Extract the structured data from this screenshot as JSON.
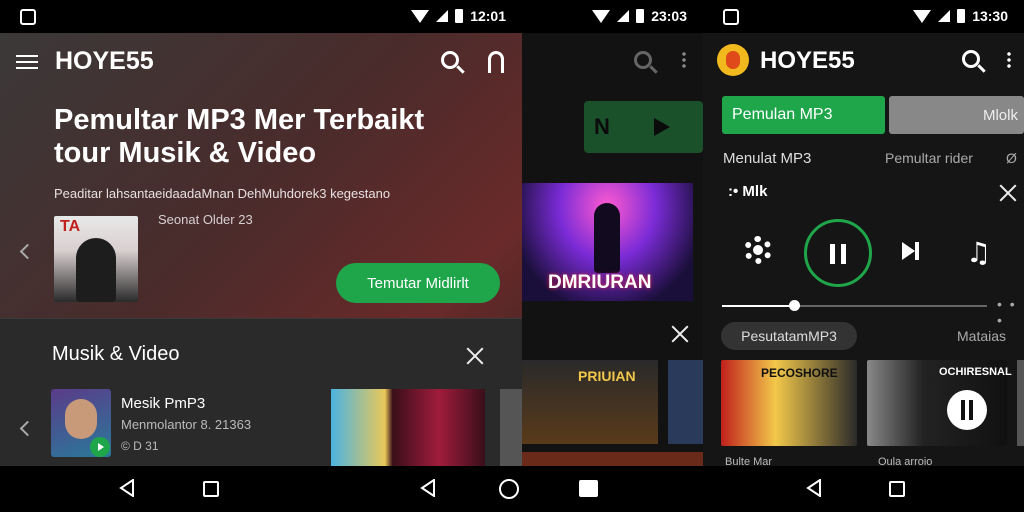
{
  "panel1": {
    "status_time": "12:01",
    "app_title": "HOYE55",
    "hero": {
      "title": "Pemultar MP3 Mer Terbaikt tour Musik & Video",
      "subtitle": "Peaditar lahsantaeidaadaMnan DehMuhdorek3 kegestano",
      "meta": "Seonat Older 23",
      "cta_label": "Temutar Midlirlt",
      "thumb_text": "TA"
    },
    "sheet": {
      "title": "Musik & Video",
      "item": {
        "title": "Mesik PmP3",
        "subtitle": "Menmolantor 8. 21363",
        "meta": "© D 31"
      }
    }
  },
  "panel2": {
    "status_time": "23:03",
    "green_letter": "N",
    "concert_label": "DMRIURAN",
    "row_label": "PRIUIAN"
  },
  "panel3": {
    "status_time": "13:30",
    "app_title": "HOYE55",
    "tabs": [
      {
        "label": "Pemulan MP3"
      },
      {
        "label": "Mlolk"
      }
    ],
    "headers": [
      "Menulat MP3",
      "Pemultar rider",
      "Ø"
    ],
    "now_playing": ":• Mlk",
    "note_glyph": "♫",
    "progress": 0.27,
    "seek_dots": "• • •",
    "chip": "PesutatamMP3",
    "chip2": "Mataias",
    "card1_label": "PECOSHORE",
    "card2_label": "OCHIRESNAL",
    "foot1": "Bulte Mar",
    "foot2": "Oula arroio"
  },
  "colors": {
    "accent_green": "#1fa64a",
    "statusbar": "#000000",
    "sheet_bg": "#2a2a2a"
  },
  "icons": {
    "menu": "menu-icon",
    "search": "search-icon",
    "headset": "headset-icon",
    "close": "close-icon",
    "gear": "gear-icon",
    "pause": "pause-icon",
    "next": "skip-next-icon",
    "note": "music-note-icon"
  }
}
